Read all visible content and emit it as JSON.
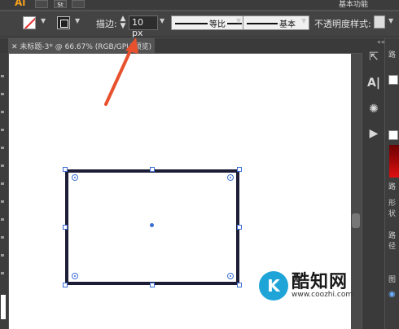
{
  "app": {
    "logo": "Ai",
    "workspace": "基本功能"
  },
  "control_bar": {
    "stroke_label": "描边:",
    "stroke_value": "10 px",
    "profile_label": "等比",
    "brush_label": "基本",
    "opacity_label": "不透明度",
    "style_label": "样式:"
  },
  "tabs": [
    {
      "label": "未标题-3* @ 66.67% (RGB/GPU 预览)"
    }
  ],
  "panels": {
    "labels": [
      "路",
      "形状",
      "路径",
      "图"
    ]
  },
  "watermark": {
    "title": "酷知网",
    "url": "www.coozhi.com"
  },
  "colors": {
    "accent": "#e8512d",
    "selection": "#3b6fd6",
    "stroke": "#1c1c36"
  },
  "icons": [
    "fill-icon",
    "stroke-icon",
    "stepper-icon",
    "arrange-icon",
    "character-icon",
    "sun-icon",
    "play-icon"
  ]
}
